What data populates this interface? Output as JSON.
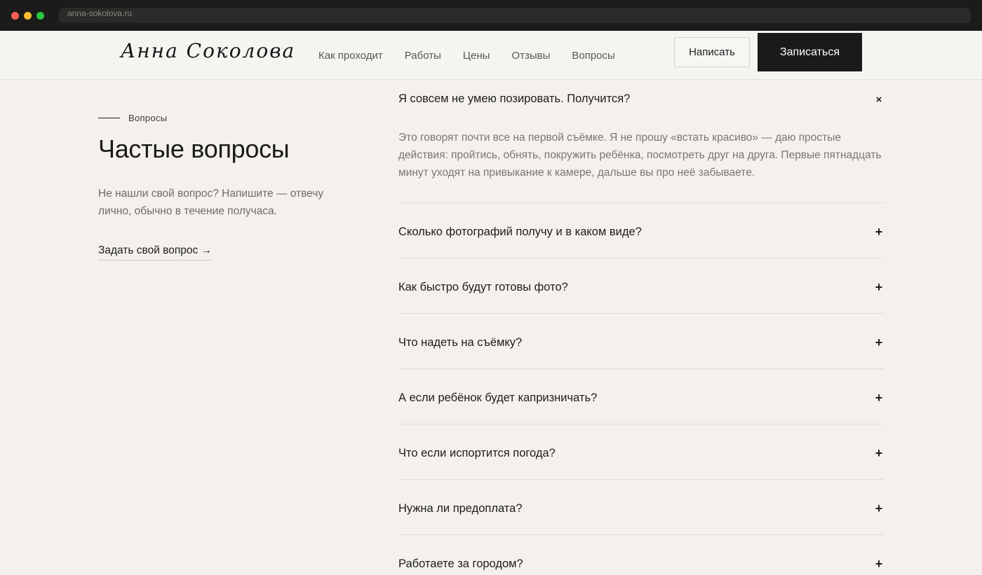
{
  "browser": {
    "url": "anna-sokolova.ru"
  },
  "header": {
    "logo": "Анна Соколова",
    "nav": [
      "Как проходит",
      "Работы",
      "Цены",
      "Отзывы",
      "Вопросы"
    ],
    "write_label": "Написать",
    "book_label": "Записаться"
  },
  "intro": {
    "eyebrow": "Вопросы",
    "title": "Частые вопросы",
    "description": "Не нашли свой вопрос? Напишите — отвечу лично, обычно в течение получаса.",
    "ask_link": "Задать свой вопрос →"
  },
  "faq": [
    {
      "question": "Я совсем не умею позировать. Получится?",
      "toggle": "×",
      "open": true,
      "answer": "Это говорят почти все на первой съёмке. Я не прошу «встать красиво» — даю простые действия: пройтись, обнять, покружить ребёнка, посмотреть друг на друга. Первые пятнадцать минут уходят на привыкание к камере, дальше вы про неё забываете."
    },
    {
      "question": "Сколько фотографий получу и в каком виде?",
      "toggle": "+"
    },
    {
      "question": "Как быстро будут готовы фото?",
      "toggle": "+"
    },
    {
      "question": "Что надеть на съёмку?",
      "toggle": "+"
    },
    {
      "question": "А если ребёнок будет капризничать?",
      "toggle": "+"
    },
    {
      "question": "Что если испортится погода?",
      "toggle": "+"
    },
    {
      "question": "Нужна ли предоплата?",
      "toggle": "+"
    },
    {
      "question": "Работаете за городом?",
      "toggle": "+"
    }
  ]
}
